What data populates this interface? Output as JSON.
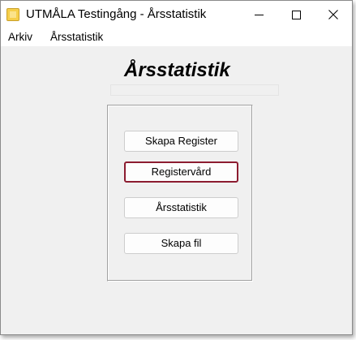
{
  "window": {
    "title": "UTMÅLA Testingång - Årsstatistik"
  },
  "menu": {
    "items": [
      "Arkiv",
      "Årsstatistik"
    ]
  },
  "main": {
    "heading": "Årsstatistik",
    "buttons": {
      "skapa_register": "Skapa Register",
      "registervard": "Registervård",
      "arsstatistik": "Årsstatistik",
      "skapa_fil": "Skapa fil"
    },
    "focused_button": "Registervård"
  },
  "colors": {
    "focus_border": "#8c1c30",
    "app_icon": "#f6cf4a",
    "window_bg": "#f0f0f0"
  }
}
